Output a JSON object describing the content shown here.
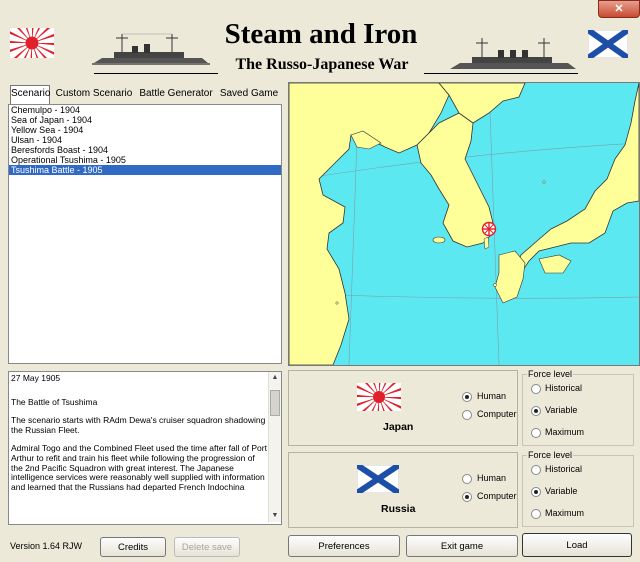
{
  "window": {
    "close_label": "✕"
  },
  "header": {
    "title": "Steam and Iron",
    "subtitle": "The Russo-Japanese War"
  },
  "tabs": [
    {
      "label": "Scenario"
    },
    {
      "label": "Custom Scenario"
    },
    {
      "label": "Battle Generator"
    },
    {
      "label": "Saved Game"
    }
  ],
  "scenarios": [
    {
      "label": "Chemulpo - 1904"
    },
    {
      "label": "Sea of Japan - 1904"
    },
    {
      "label": "Yellow Sea - 1904"
    },
    {
      "label": "Ulsan - 1904"
    },
    {
      "label": "Beresfords Boast - 1904"
    },
    {
      "label": "Operational Tsushima - 1905"
    },
    {
      "label": "Tsushima Battle - 1905"
    }
  ],
  "selected_index": 6,
  "description": {
    "date": "27 May 1905",
    "heading": "The Battle of Tsushima",
    "para1": "The scenario starts with RAdm Dewa's cruiser squadron shadowing the Russian Fleet.",
    "para2": "Admiral Togo and the Combined Fleet used the time after fall of Port Arthur to refit and train his fleet while following the progression of the 2nd Pacific Squadron with great interest.  The Japanese intelligence services were reasonably well supplied with information and learned that the Russians had departed French Indochina"
  },
  "sides": [
    {
      "nation": "Japan",
      "control_options": [
        "Human",
        "Computer"
      ],
      "control_selected": "Human",
      "force_level_title": "Force level",
      "force_options": [
        "Historical",
        "Variable",
        "Maximum"
      ],
      "force_selected": "Variable"
    },
    {
      "nation": "Russia",
      "control_options": [
        "Human",
        "Computer"
      ],
      "control_selected": "Computer",
      "force_level_title": "Force level",
      "force_options": [
        "Historical",
        "Variable",
        "Maximum"
      ],
      "force_selected": "Variable"
    }
  ],
  "footer": {
    "version": "Version 1.64 RJW",
    "credits": "Credits",
    "delete_save": "Delete save",
    "preferences": "Preferences",
    "exit_game": "Exit game",
    "load": "Load"
  },
  "colors": {
    "sea": "#5ce8f0",
    "land": "#ffff9a",
    "selection": "#316ac5",
    "japan_red": "#e0202a",
    "russia_blue": "#1e4fa8"
  }
}
